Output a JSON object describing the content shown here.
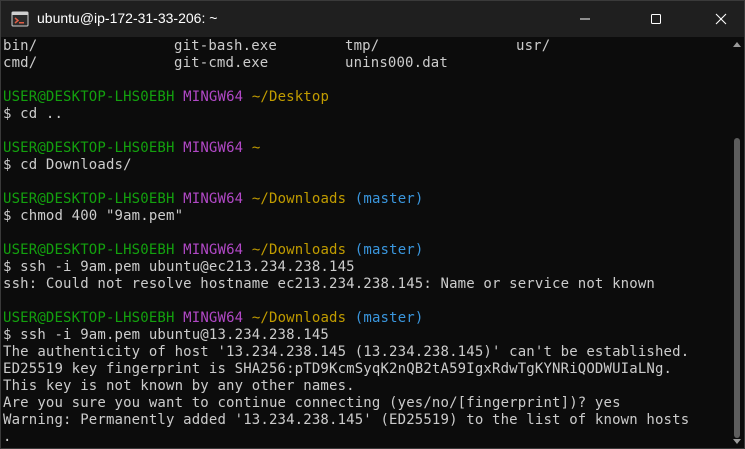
{
  "window": {
    "title": "ubuntu@ip-172-31-33-206: ~",
    "icon": "git-bash-icon",
    "controls": [
      "minimize-icon",
      "maximize-icon",
      "close-icon"
    ]
  },
  "colors": {
    "background": "#0c0c0c",
    "text": "#cccccc",
    "user_host": "#13a10e",
    "mingw": "#b148c6",
    "path": "#c19c00",
    "branch": "#3a96dd"
  },
  "listing": {
    "row1": [
      "bin/",
      "git-bash.exe",
      "tmp/",
      "usr/"
    ],
    "row2": [
      "cmd/",
      "git-cmd.exe",
      "unins000.dat"
    ]
  },
  "prompts": [
    {
      "user": "USER@DESKTOP-LHS0EBH",
      "env": "MINGW64",
      "path": "~/Desktop",
      "branch": "",
      "command": "$ cd .."
    },
    {
      "user": "USER@DESKTOP-LHS0EBH",
      "env": "MINGW64",
      "path": "~",
      "branch": "",
      "command": "$ cd Downloads/"
    },
    {
      "user": "USER@DESKTOP-LHS0EBH",
      "env": "MINGW64",
      "path": "~/Downloads",
      "branch": "(master)",
      "command": "$ chmod 400 \"9am.pem\""
    },
    {
      "user": "USER@DESKTOP-LHS0EBH",
      "env": "MINGW64",
      "path": "~/Downloads",
      "branch": "(master)",
      "command": "$ ssh -i 9am.pem ubuntu@ec213.234.238.145"
    },
    {
      "user": "USER@DESKTOP-LHS0EBH",
      "env": "MINGW64",
      "path": "~/Downloads",
      "branch": "(master)",
      "command": "$ ssh -i 9am.pem ubuntu@13.234.238.145"
    }
  ],
  "outputs": {
    "ssh_error": "ssh: Could not resolve hostname ec213.234.238.145: Name or service not known",
    "auth1": "The authenticity of host '13.234.238.145 (13.234.238.145)' can't be established.",
    "auth2": "ED25519 key fingerprint is SHA256:pTD9KcmSyqK2nQB2tA59IgxRdwTgKYNRiQODWUIaLNg.",
    "auth3": "This key is not known by any other names.",
    "auth4": "Are you sure you want to continue connecting (yes/no/[fingerprint])? yes",
    "auth5": "Warning: Permanently added '13.234.238.145' (ED25519) to the list of known hosts",
    "auth6": "."
  }
}
